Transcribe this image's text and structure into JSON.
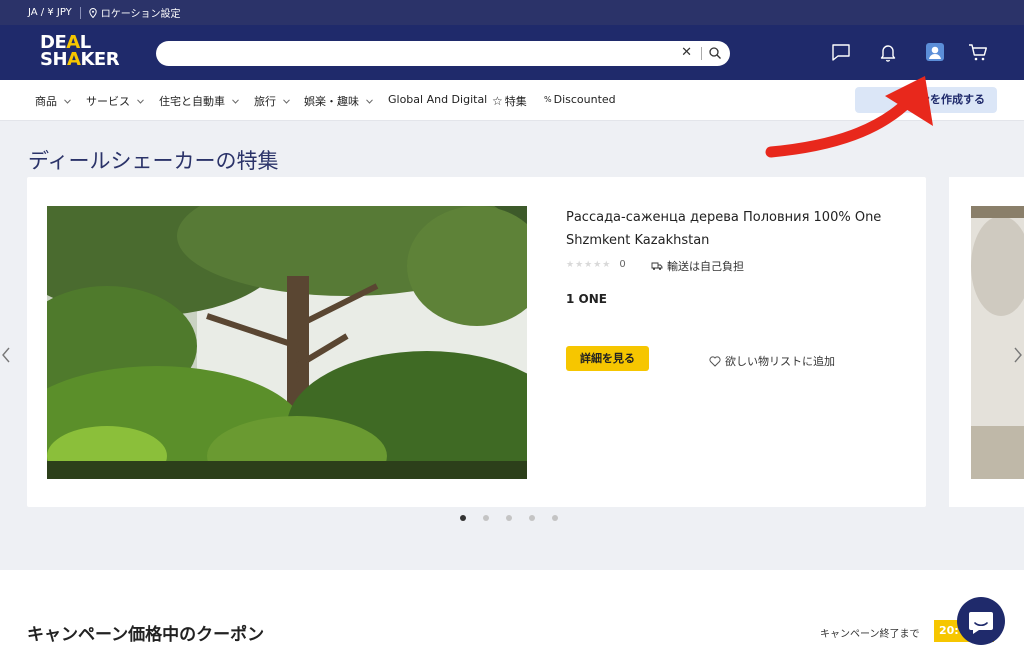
{
  "topbar": {
    "lang_currency": "JA / ¥ JPY",
    "location": "ロケーション設定"
  },
  "logo": {
    "line1": "DEAL",
    "line2": "SHAKER"
  },
  "search": {
    "value": "",
    "placeholder": ""
  },
  "nav": {
    "items": [
      {
        "label": "商品"
      },
      {
        "label": "サービス"
      },
      {
        "label": "住宅と自動車"
      },
      {
        "label": "旅行"
      },
      {
        "label": "娯楽・趣味"
      },
      {
        "label": "Global And Digital"
      },
      {
        "label": "特集"
      },
      {
        "label": "Discounted"
      }
    ],
    "create_button": "ンを作成する"
  },
  "section": {
    "title": "ディールシェーカーの特集"
  },
  "product": {
    "title": "Рассада-саженца дерева Половния 100% One Shzmkent Kazakhstan",
    "rating_count": "0",
    "shipping": "輸送は自己負担",
    "price": "1 ONE",
    "detail_button": "詳細を見る",
    "wishlist": "欲しい物リストに追加"
  },
  "carousel": {
    "dot_count": 5,
    "active_dot": 0
  },
  "coupon": {
    "title": "キャンペーン価格中のクーポン",
    "ends_label": "キャンペーン終了まで",
    "timer": "20:"
  },
  "colors": {
    "header": "#1f2a6b",
    "topbar": "#2b3369",
    "accent": "#f6c600",
    "annotation_arrow": "#e8281c"
  },
  "icons": [
    "pin-icon",
    "clear-icon",
    "search-icon",
    "message-icon",
    "bell-icon",
    "user-account-icon",
    "cart-icon",
    "chevron-down-icon",
    "star-outline-icon",
    "percent-icon",
    "delivery-icon",
    "heart-icon",
    "chevron-left-icon",
    "chevron-right-icon",
    "chat-bubble-icon"
  ]
}
